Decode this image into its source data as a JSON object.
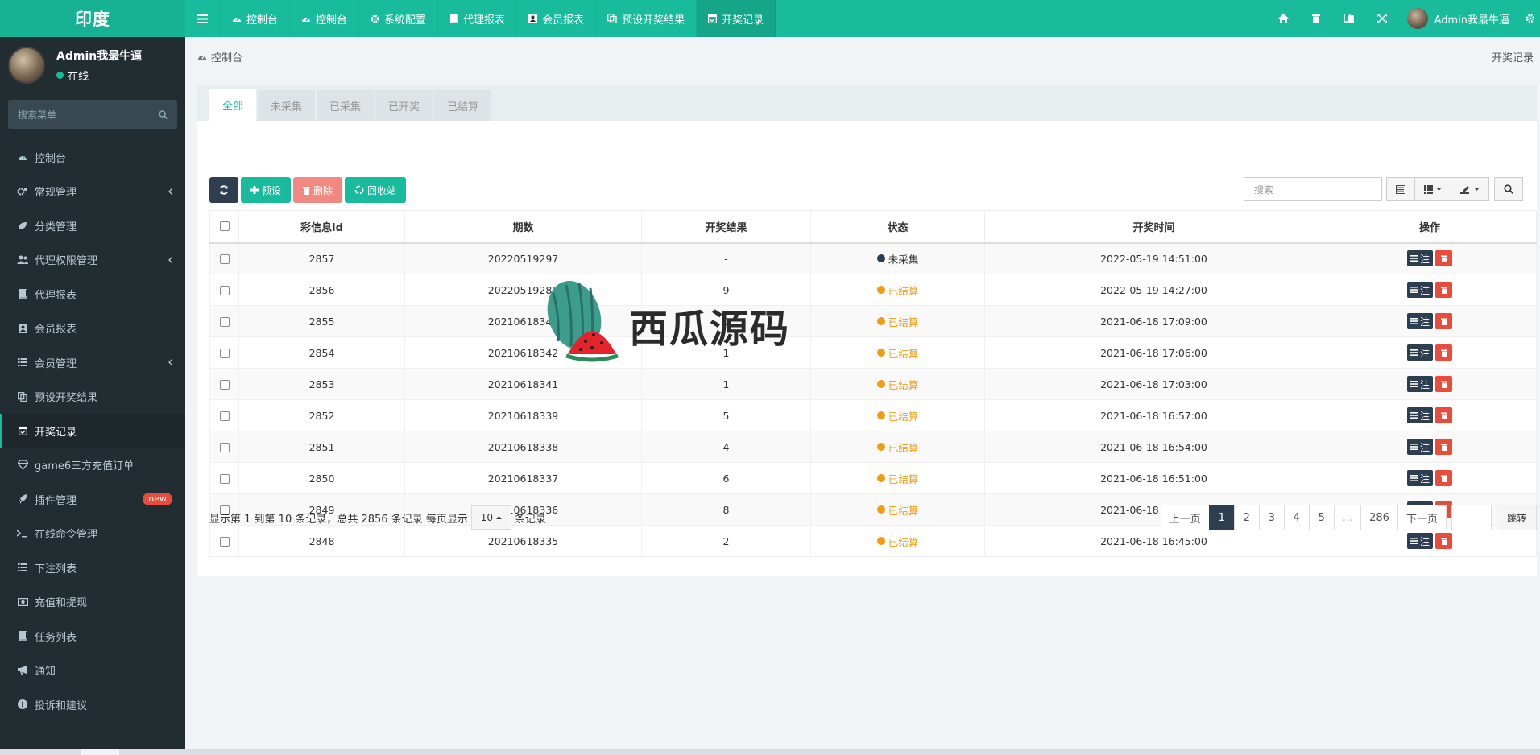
{
  "brand": "印度",
  "topnav": [
    {
      "label": "控制台",
      "icon": "dashboard-icon"
    },
    {
      "label": "控制台",
      "icon": "dashboard-icon"
    },
    {
      "label": "系统配置",
      "icon": "gear-icon"
    },
    {
      "label": "代理报表",
      "icon": "book-icon"
    },
    {
      "label": "会员报表",
      "icon": "id-card-icon"
    },
    {
      "label": "预设开奖结果",
      "icon": "copy-icon"
    },
    {
      "label": "开奖记录",
      "icon": "calendar-check-icon",
      "active": true
    }
  ],
  "topuser": {
    "name": "Admin我最牛逼"
  },
  "sidebar": {
    "user": {
      "name": "Admin我最牛逼",
      "status": "在线"
    },
    "search_placeholder": "搜索菜单",
    "items": [
      {
        "label": "控制台",
        "icon": "dashboard-icon"
      },
      {
        "label": "常规管理",
        "icon": "cogs-icon",
        "arrow": true
      },
      {
        "label": "分类管理",
        "icon": "leaf-icon"
      },
      {
        "label": "代理权限管理",
        "icon": "users-icon",
        "arrow": true
      },
      {
        "label": "代理报表",
        "icon": "book-icon"
      },
      {
        "label": "会员报表",
        "icon": "id-card-icon"
      },
      {
        "label": "会员管理",
        "icon": "list-icon",
        "arrow": true
      },
      {
        "label": "预设开奖结果",
        "icon": "copy-icon"
      },
      {
        "label": "开奖记录",
        "icon": "calendar-check-icon",
        "active": true
      },
      {
        "label": "game6三方充值订单",
        "icon": "diamond-icon"
      },
      {
        "label": "插件管理",
        "icon": "rocket-icon",
        "badge": "new"
      },
      {
        "label": "在线命令管理",
        "icon": "terminal-icon"
      },
      {
        "label": "下注列表",
        "icon": "list-icon"
      },
      {
        "label": "充值和提现",
        "icon": "money-icon"
      },
      {
        "label": "任务列表",
        "icon": "book-icon"
      },
      {
        "label": "通知",
        "icon": "bullhorn-icon"
      },
      {
        "label": "投诉和建议",
        "icon": "info-circle-icon"
      }
    ]
  },
  "breadcrumb": {
    "home": "控制台",
    "current": "开奖记录"
  },
  "tabs": [
    "全部",
    "未采集",
    "已采集",
    "已开奖",
    "已结算"
  ],
  "toolbar": {
    "add": "预设",
    "delete": "删除",
    "recycle": "回收站"
  },
  "search_placeholder": "搜索",
  "table": {
    "columns": [
      "彩信息id",
      "期数",
      "开奖结果",
      "状态",
      "开奖时间",
      "操作"
    ],
    "op_label": "注",
    "rows": [
      {
        "id": "2857",
        "period": "20220519297",
        "result": "-",
        "status": "未采集",
        "status_color": "#2c3e50",
        "time": "2022-05-19 14:51:00"
      },
      {
        "id": "2856",
        "period": "20220519289",
        "result": "9",
        "status": "已结算",
        "status_color": "#f39c12",
        "time": "2022-05-19 14:27:00"
      },
      {
        "id": "2855",
        "period": "20210618343",
        "result": "0",
        "status": "已结算",
        "status_color": "#f39c12",
        "time": "2021-06-18 17:09:00"
      },
      {
        "id": "2854",
        "period": "20210618342",
        "result": "1",
        "status": "已结算",
        "status_color": "#f39c12",
        "time": "2021-06-18 17:06:00"
      },
      {
        "id": "2853",
        "period": "20210618341",
        "result": "1",
        "status": "已结算",
        "status_color": "#f39c12",
        "time": "2021-06-18 17:03:00"
      },
      {
        "id": "2852",
        "period": "20210618339",
        "result": "5",
        "status": "已结算",
        "status_color": "#f39c12",
        "time": "2021-06-18 16:57:00"
      },
      {
        "id": "2851",
        "period": "20210618338",
        "result": "4",
        "status": "已结算",
        "status_color": "#f39c12",
        "time": "2021-06-18 16:54:00"
      },
      {
        "id": "2850",
        "period": "20210618337",
        "result": "6",
        "status": "已结算",
        "status_color": "#f39c12",
        "time": "2021-06-18 16:51:00"
      },
      {
        "id": "2849",
        "period": "20210618336",
        "result": "8",
        "status": "已结算",
        "status_color": "#f39c12",
        "time": "2021-06-18 16:48:00"
      },
      {
        "id": "2848",
        "period": "20210618335",
        "result": "2",
        "status": "已结算",
        "status_color": "#f39c12",
        "time": "2021-06-18 16:45:00"
      }
    ]
  },
  "footer": {
    "summary": "显示第 1 到第 10 条记录，总共 2856 条记录 每页显示",
    "page_size": "10",
    "suffix": "条记录"
  },
  "pager": {
    "prev": "上一页",
    "pages": [
      "1",
      "2",
      "3",
      "4",
      "5",
      "...",
      "286"
    ],
    "active_page": "1",
    "next": "下一页",
    "jump": "跳转"
  },
  "watermark": "西瓜源码"
}
